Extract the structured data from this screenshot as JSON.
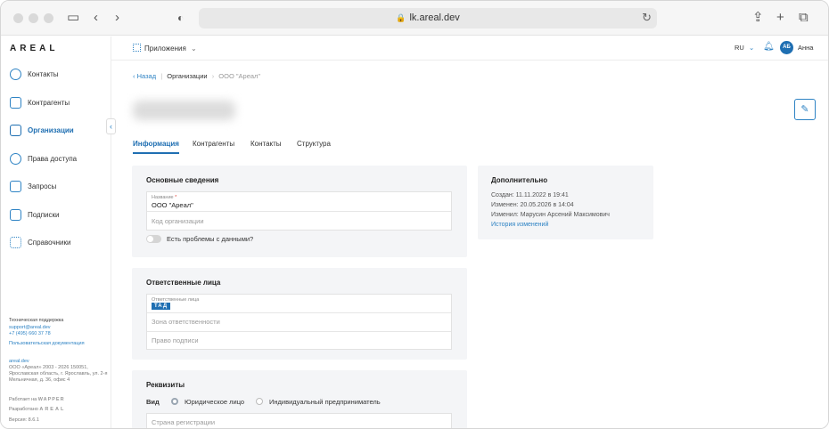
{
  "browser": {
    "url": "lk.areal.dev",
    "lock_icon": "lock-icon",
    "reload_icon": "reload-icon",
    "sidebar_toggle_icon": "sidebar-toggle-icon",
    "back_icon": "back-icon",
    "forward_icon": "forward-icon",
    "shield_icon": "shield-icon",
    "share_icon": "share-icon",
    "new_tab_icon": "plus-icon",
    "tabs_icon": "tabs-icon"
  },
  "sidebar": {
    "logo": "AREAL",
    "items": [
      {
        "label": "Контакты",
        "icon": "contacts-icon"
      },
      {
        "label": "Контрагенты",
        "icon": "counterparties-icon"
      },
      {
        "label": "Организации",
        "icon": "organizations-icon",
        "active": true
      },
      {
        "label": "Права доступа",
        "icon": "key-icon"
      },
      {
        "label": "Запросы",
        "icon": "requests-icon"
      },
      {
        "label": "Подписки",
        "icon": "subscriptions-icon"
      },
      {
        "label": "Справочники",
        "icon": "catalogs-icon"
      }
    ],
    "collapse_icon": "chevron-left-icon",
    "support_title": "Техническая поддержка",
    "support_email": "support@areal.dev",
    "support_phone": "+7 (495) 660 37 78",
    "docs_link": "Пользовательская документация",
    "site_link": "areal.dev",
    "copyright": "ООО «Ареал» 2003 - 2026 150051,",
    "address1": "Ярославская область, г. Ярославль, ул. 2-я",
    "address2": "Мельничная, д. 36, офис 4",
    "works_on": "Работает на",
    "works_on_brand": "WAPPER",
    "developed": "Разработано",
    "developed_brand": "AREAL",
    "version": "Версия: 8.6.1"
  },
  "topbar": {
    "apps_label": "Приложения",
    "apps_icon": "apps-grid-icon",
    "apps_chevron": "chevron-down-icon",
    "lang": "RU",
    "lang_chevron": "chevron-down-icon",
    "bell_icon": "bell-icon",
    "avatar_initials": "АБ",
    "user_name": "Анна"
  },
  "breadcrumb": {
    "back": "Назад",
    "section": "Организации",
    "current": "ООО \"Ареал\""
  },
  "page": {
    "edit_icon": "edit-icon",
    "tabs": [
      "Информация",
      "Контрагенты",
      "Контакты",
      "Структура"
    ],
    "active_tab": 0
  },
  "basic": {
    "title": "Основные сведения",
    "name_label": "Название",
    "name_value": "ООО \"Ареал\"",
    "code_placeholder": "Код организации",
    "problems_label": "Есть проблемы с данными?"
  },
  "responsible": {
    "title": "Ответственные лица",
    "persons_label": "Ответственные лица",
    "person_chip": "ТАД",
    "zone_placeholder": "Зона ответственности",
    "sign_placeholder": "Право подписи"
  },
  "requisites": {
    "title": "Реквизиты",
    "kind_label": "Вид",
    "option_legal": "Юридическое лицо",
    "option_ip": "Индивидуальный предприниматель",
    "country_placeholder": "Страна регистрации"
  },
  "extra": {
    "title": "Дополнительно",
    "created": "Создан: 11.11.2022 в 19:41",
    "changed": "Изменен: 20.05.2026 в 14:04",
    "changed_by": "Изменил: Марусин Арсений Максимович",
    "history_link": "История изменений"
  },
  "colors": {
    "accent": "#1f6fb2",
    "link": "#2e83c4",
    "card_bg": "#f4f5f7",
    "required": "#e0453a"
  }
}
